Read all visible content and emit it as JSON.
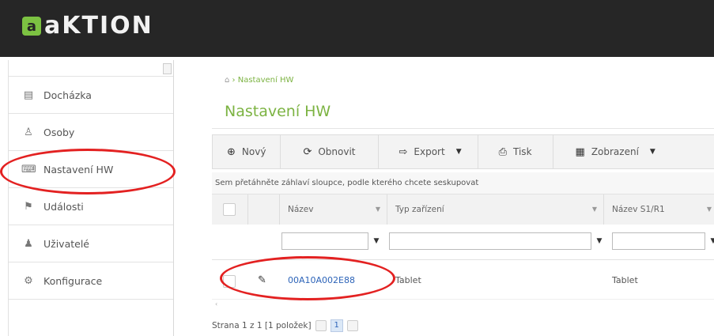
{
  "brand": {
    "logo_mark": "a",
    "logo_text": "aKTION"
  },
  "sidebar": {
    "items": [
      {
        "label": "Docházka",
        "icon": "calendar-icon",
        "glyph": "▤"
      },
      {
        "label": "Osoby",
        "icon": "person-icon",
        "glyph": "♙"
      },
      {
        "label": "Nastavení HW",
        "icon": "hardware-icon",
        "glyph": "⌨"
      },
      {
        "label": "Události",
        "icon": "events-icon",
        "glyph": "⚑"
      },
      {
        "label": "Uživatelé",
        "icon": "users-icon",
        "glyph": "♟"
      },
      {
        "label": "Konfigurace",
        "icon": "gears-icon",
        "glyph": "⚙"
      }
    ]
  },
  "breadcrumb": {
    "home_glyph": "⌂",
    "separator": "›",
    "current": "Nastavení HW"
  },
  "page": {
    "title": "Nastavení HW"
  },
  "toolbar": {
    "buttons": [
      {
        "label": "Nový",
        "icon": "plus-circle-icon",
        "glyph": "⊕"
      },
      {
        "label": "Obnovit",
        "icon": "refresh-icon",
        "glyph": "⟳"
      },
      {
        "label": "Export",
        "icon": "export-icon",
        "glyph": "⇨"
      },
      {
        "label": "Tisk",
        "icon": "print-icon",
        "glyph": "⎙"
      },
      {
        "label": "Zobrazení",
        "icon": "view-icon",
        "glyph": "▦"
      }
    ],
    "caret": "▼"
  },
  "grid": {
    "group_hint": "Sem přetáhněte záhlaví sloupce, podle kterého chcete seskupovat",
    "columns": [
      "Název",
      "Typ zařízení",
      "Název S1/R1"
    ],
    "filter_glyph": "▼",
    "rows": [
      {
        "name": "00A10A002E88",
        "type": "Tablet",
        "s1r1": "Tablet"
      }
    ],
    "edit_glyph": "✎",
    "scroll_glyph": "‹"
  },
  "pager": {
    "text": "Strana 1 z 1 [1 položek]",
    "current_page": "1"
  },
  "colors": {
    "accent_green": "#7cb342",
    "link_blue": "#2c63b8",
    "annotation_red": "#e32121",
    "topbar": "#262626"
  }
}
